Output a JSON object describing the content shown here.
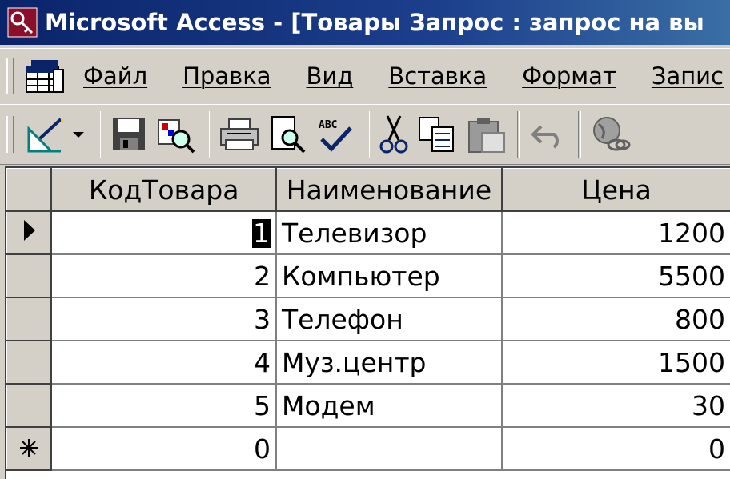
{
  "window": {
    "title": "Microsoft Access - [Товары Запрос : запрос на вы"
  },
  "menu": {
    "items": [
      {
        "label": "Файл"
      },
      {
        "label": "Правка"
      },
      {
        "label": "Вид"
      },
      {
        "label": "Вставка"
      },
      {
        "label": "Формат"
      },
      {
        "label": "Запис"
      }
    ]
  },
  "toolbar": {
    "buttons": [
      "design-view-icon",
      "dropdown-arrow-icon",
      "save-icon",
      "search-file-icon",
      "print-icon",
      "print-preview-icon",
      "spelling-icon",
      "cut-icon",
      "copy-icon",
      "paste-icon",
      "undo-icon",
      "web-icon"
    ]
  },
  "grid": {
    "columns": [
      "КодТовара",
      "Наименование",
      "Цена"
    ],
    "rows": [
      {
        "marker": "current",
        "id": "1",
        "name": "Телевизор",
        "price": "1200"
      },
      {
        "marker": "",
        "id": "2",
        "name": "Компьютер",
        "price": "5500"
      },
      {
        "marker": "",
        "id": "3",
        "name": "Телефон",
        "price": "800"
      },
      {
        "marker": "",
        "id": "4",
        "name": "Муз.центр",
        "price": "1500"
      },
      {
        "marker": "",
        "id": "5",
        "name": "Модем",
        "price": "30"
      },
      {
        "marker": "new",
        "id": "0",
        "name": "",
        "price": "0"
      }
    ]
  },
  "colors": {
    "titlebar": "#0a246a",
    "chrome": "#d4d0c8"
  }
}
